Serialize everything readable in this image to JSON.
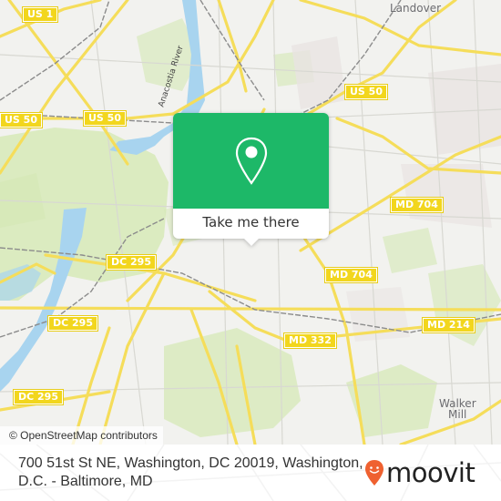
{
  "map": {
    "attribution": "© OpenStreetMap contributors",
    "colors": {
      "land": "#f2f2ef",
      "park": "#d4e8b4",
      "water": "#a8d4ef",
      "road_major": "#f5dd5a",
      "road_minor": "#d8d8d2",
      "rail": "#8c8c8c",
      "urban": "#e9e4e2"
    },
    "river_label": "Anacostia River",
    "place_labels": [
      {
        "id": "landover",
        "text": "Landover"
      },
      {
        "id": "walker-mill-1",
        "text": "Walker"
      },
      {
        "id": "walker-mill-2",
        "text": "Mill"
      }
    ],
    "route_shields": [
      {
        "id": "us1",
        "text": "US 1"
      },
      {
        "id": "us50-west",
        "text": "US 50"
      },
      {
        "id": "us50-center",
        "text": "US 50"
      },
      {
        "id": "us50-east",
        "text": "US 50"
      },
      {
        "id": "md704-north",
        "text": "MD 704"
      },
      {
        "id": "md704-south",
        "text": "MD 704"
      },
      {
        "id": "dc295-north",
        "text": "DC 295"
      },
      {
        "id": "dc295-mid",
        "text": "DC 295"
      },
      {
        "id": "dc295-south",
        "text": "DC 295"
      },
      {
        "id": "md332",
        "text": "MD 332"
      },
      {
        "id": "md214",
        "text": "MD 214"
      }
    ]
  },
  "popup": {
    "icon": "map-pin-icon",
    "button_label": "Take me there",
    "accent": "#1db868"
  },
  "footer": {
    "address": "700 51st St NE, Washington, DC 20019, Washington, D.C. - Baltimore, MD",
    "brand": "moovit",
    "brand_icon": "moovit-pin-icon",
    "brand_color": "#ef6130"
  }
}
